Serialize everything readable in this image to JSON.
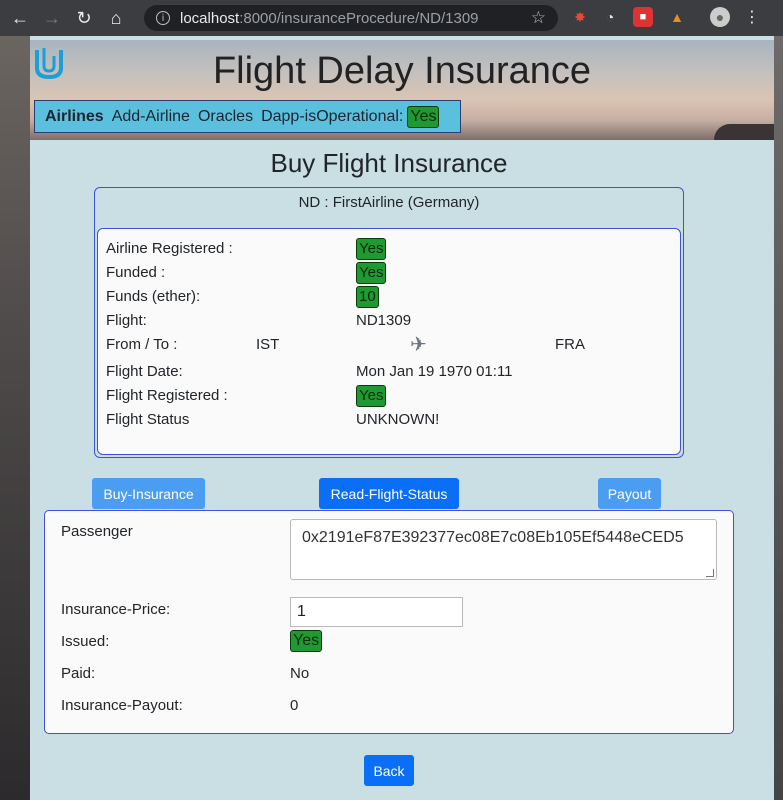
{
  "browser": {
    "url_host": "localhost",
    "url_rest": ":8000/insuranceProcedure/ND/1309"
  },
  "header": {
    "title": "Flight Delay Insurance",
    "nav": {
      "brand": "Airlines",
      "items": [
        "Add-Airline",
        "Oracles",
        "Dapp-isOperational:"
      ],
      "operational_value": "Yes"
    }
  },
  "page_title": "Buy Flight Insurance",
  "flight_card": {
    "header": "ND : FirstAirline (Germany)",
    "airline_registered_label": "Airline Registered :",
    "airline_registered_value": "Yes",
    "funded_label": "Funded :",
    "funded_value": "Yes",
    "funds_label": "Funds (ether):",
    "funds_value": "10",
    "flight_label": "Flight:",
    "flight_value": "ND1309",
    "from_to_label": "From / To :",
    "from": "IST",
    "to": "FRA",
    "flight_date_label": "Flight Date:",
    "flight_date_value": "Mon Jan 19 1970 01:11",
    "flight_registered_label": "Flight Registered :",
    "flight_registered_value": "Yes",
    "flight_status_label": "Flight Status",
    "flight_status_value": "UNKNOWN!"
  },
  "actions": {
    "buy": "Buy-Insurance",
    "read_status": "Read-Flight-Status",
    "payout": "Payout"
  },
  "insurance_card": {
    "passenger_label": "Passenger",
    "passenger_value": "0x2191eF87E392377ec08E7c08Eb105Ef5448eCED5",
    "price_label": "Insurance-Price:",
    "price_value": "1",
    "issued_label": "Issued:",
    "issued_value": "Yes",
    "paid_label": "Paid:",
    "paid_value": "No",
    "payout_label": "Insurance-Payout:",
    "payout_value": "0"
  },
  "back_button": "Back",
  "colors": {
    "page_bg": "#c9dfe3",
    "navbar_bg": "#5bc0de",
    "badge_green": "#1f9a32",
    "card_border": "#3f51d8",
    "button_primary": "#0a6ef7",
    "button_light": "#4b9df2"
  }
}
